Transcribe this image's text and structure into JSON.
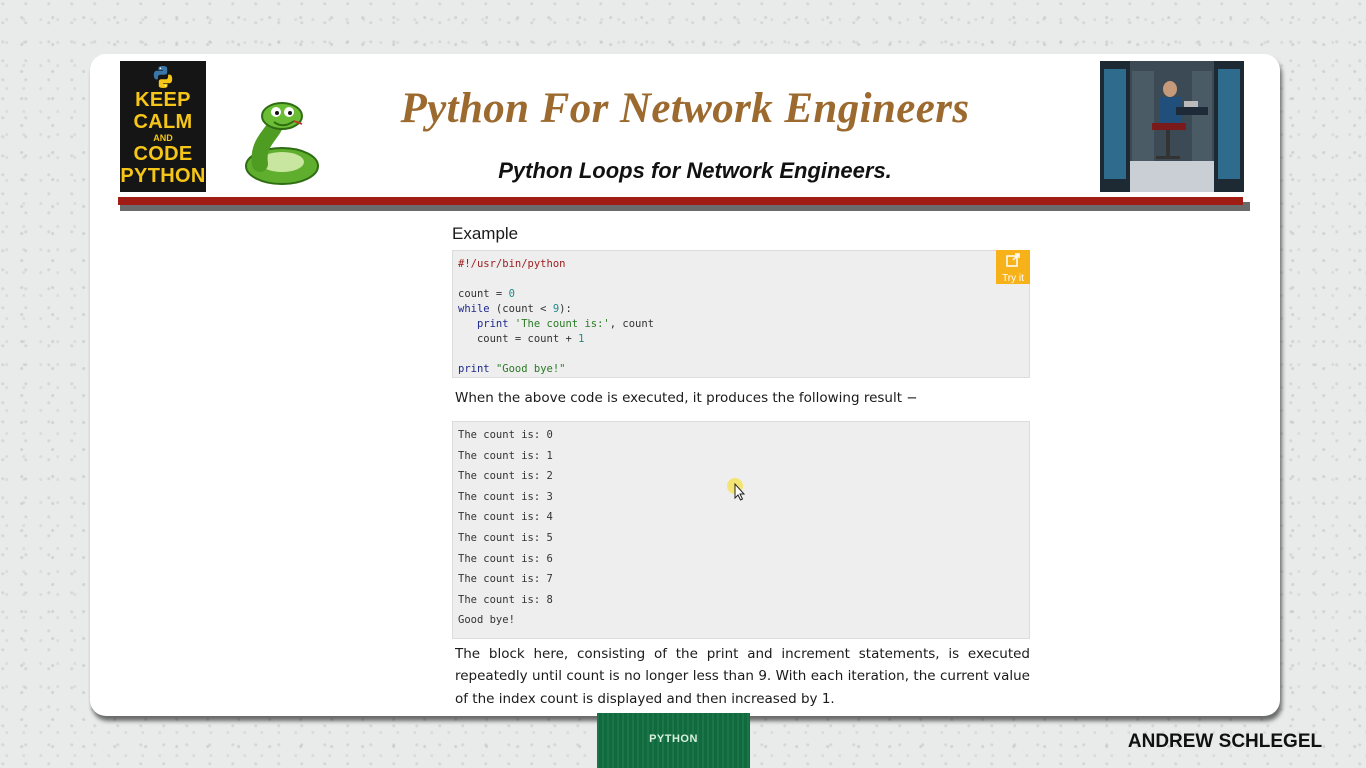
{
  "logo": {
    "keep_calm_lines": [
      "KEEP",
      "CALM",
      "AND",
      "CODE",
      "PYTHON"
    ]
  },
  "header": {
    "title": "Python For Network Engineers",
    "subtitle": "Python Loops for Network Engineers."
  },
  "content": {
    "example_heading": "Example",
    "code_lines": [
      "#!/usr/bin/python",
      "",
      "count = 0",
      "while (count < 9):",
      "   print 'The count is:', count",
      "   count = count + 1",
      "",
      "print \"Good bye!\""
    ],
    "try_it_label": "Try it",
    "paragraph1": "When the above code is executed, it produces the following result −",
    "output_lines": [
      "The count is: 0",
      "The count is: 1",
      "The count is: 2",
      "The count is: 3",
      "The count is: 4",
      "The count is: 5",
      "The count is: 6",
      "The count is: 7",
      "The count is: 8",
      "Good bye!"
    ],
    "paragraph2": "The block here, consisting of the print and increment statements, is executed repeatedly until count is no longer less than 9. With each iteration, the current value of the index count is displayed and then increased by 1."
  },
  "footer": {
    "banner_label": "PYTHON",
    "author": "ANDREW SCHLEGEL"
  },
  "colors": {
    "title": "#9c6a2e",
    "divider": "#a11c14",
    "try_it": "#f7b21a",
    "keep_calm_text": "#f5c518"
  },
  "icons": [
    "python-logo-icon",
    "snake-mascot-icon",
    "external-link-icon",
    "mouse-pointer-icon"
  ]
}
